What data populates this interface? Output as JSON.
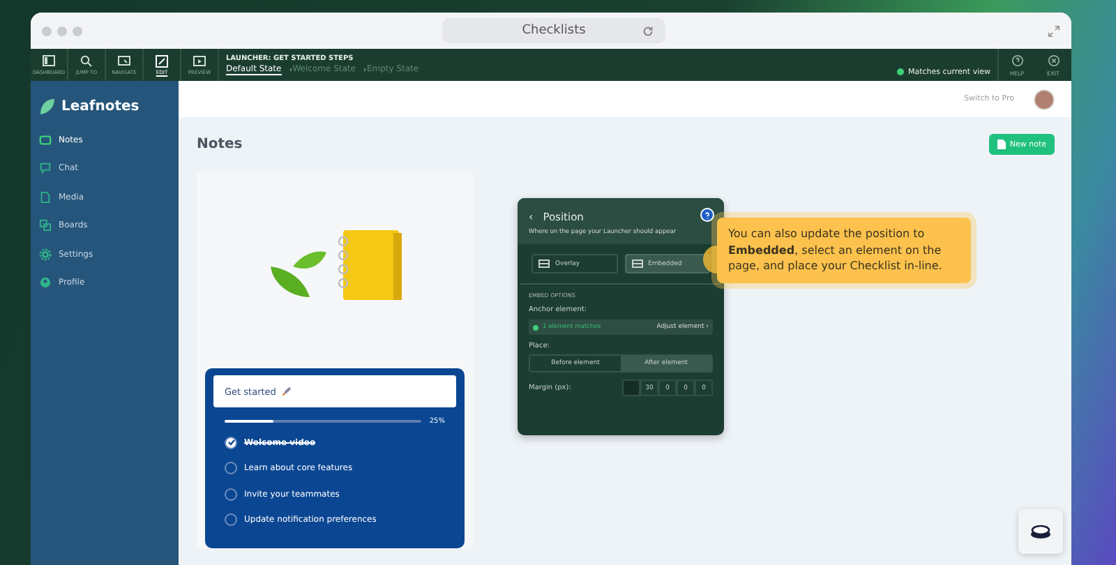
{
  "browser": {
    "address": "Checklists"
  },
  "toolbar": {
    "tools": [
      {
        "label": "DASHBOARD",
        "kind": "dashboard",
        "selected": false
      },
      {
        "label": "JUMP TO",
        "kind": "search",
        "selected": false
      },
      {
        "label": "NAVIGATE",
        "kind": "navigate",
        "selected": false
      },
      {
        "label": "EDIT",
        "kind": "edit",
        "selected": true
      },
      {
        "label": "PREVIEW",
        "kind": "preview",
        "selected": false
      }
    ],
    "flow_title": "LAUNCHER: GET STARTED STEPS",
    "states": [
      {
        "label": "Default State",
        "selected": true
      },
      {
        "label": "Welcome State",
        "selected": false
      },
      {
        "label": "Empty State",
        "selected": false
      }
    ],
    "match_status": "Matches current view",
    "actions": [
      {
        "label": "HELP",
        "kind": "help"
      },
      {
        "label": "EXIT",
        "kind": "exit"
      }
    ]
  },
  "sidebar": {
    "brand": "Leafnotes",
    "items": [
      {
        "label": "Notes",
        "kind": "notes",
        "selected": true
      },
      {
        "label": "Chat",
        "kind": "chat",
        "selected": false
      },
      {
        "label": "Media",
        "kind": "media",
        "selected": false
      },
      {
        "label": "Boards",
        "kind": "boards",
        "selected": false
      },
      {
        "label": "Settings",
        "kind": "settings",
        "selected": false
      },
      {
        "label": "Profile",
        "kind": "profile",
        "selected": false
      }
    ]
  },
  "header": {
    "switch_link": "Switch to Pro"
  },
  "page": {
    "title": "Notes",
    "new_button": "New note"
  },
  "checklist": {
    "title": "Get started",
    "progress": {
      "level": 0.25,
      "reading": "25%"
    },
    "items": [
      {
        "label": "Welcome video",
        "checked": true
      },
      {
        "label": "Learn about core features",
        "checked": false
      },
      {
        "label": "Invite your teammates",
        "checked": false
      },
      {
        "label": "Update notification preferences",
        "checked": false
      }
    ]
  },
  "position_panel": {
    "back": "‹",
    "title": "Position",
    "subtitle": "Where on the page your Launcher should appear",
    "modes": [
      {
        "label": "Overlay",
        "selected": false
      },
      {
        "label": "Embedded",
        "selected": true
      }
    ],
    "section": "EMBED OPTIONS",
    "anchor_label": "Anchor element:",
    "anchor_status": "1 element matches",
    "adjust": "Adjust element ›",
    "place_label": "Place:",
    "places": [
      {
        "label": "Before element",
        "selected": false
      },
      {
        "label": "After element",
        "selected": true
      }
    ],
    "margin_label": "Margin (px):",
    "margins": [
      "30",
      "0",
      "0",
      "0"
    ]
  },
  "tooltip": {
    "text": "You can also update the position to **Embedded**, select an element on the page, and place your Checklist in-line."
  }
}
